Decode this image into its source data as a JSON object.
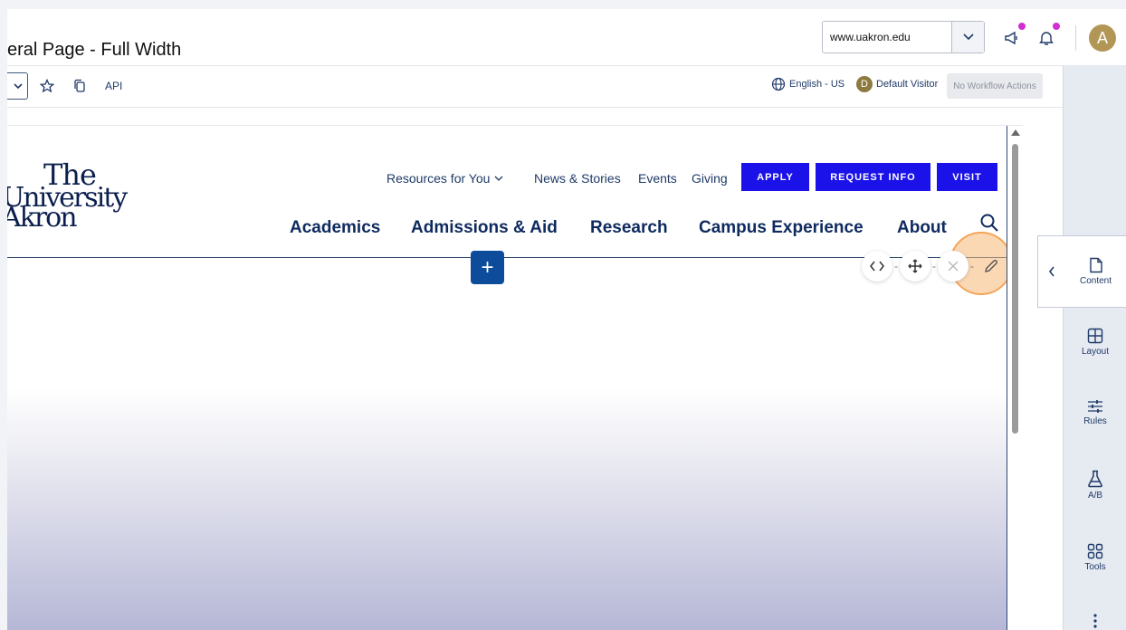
{
  "header": {
    "page_title": "eral Page - Full Width",
    "site_selector_value": "www.uakron.edu",
    "avatar_initial": "A"
  },
  "toolbar": {
    "api_label": "API",
    "language": "English - US",
    "visitor_initial": "D",
    "visitor": "Default Visitor",
    "workflow": "No Workflow Actions"
  },
  "site": {
    "logo_line1": "The",
    "logo_line2": "University",
    "logo_line3": "Akron",
    "utility_nav": [
      "Resources for You",
      "News & Stories",
      "Events",
      "Giving"
    ],
    "cta_buttons": [
      "APPLY",
      "REQUEST INFO",
      "VISIT"
    ],
    "main_nav": [
      "Academics",
      "Admissions & Aid",
      "Research",
      "Campus Experience",
      "About"
    ]
  },
  "editor": {
    "add_label": "+"
  },
  "sidebar": {
    "content": "Content",
    "layout": "Layout",
    "rules": "Rules",
    "ab": "A/B",
    "tools": "Tools"
  },
  "colors": {
    "cta_blue": "#1a12e8",
    "navy": "#0f2a5e",
    "add_button": "#0d4b9b",
    "highlight": "#f4a55a",
    "notification_dot": "#d12fd1"
  }
}
